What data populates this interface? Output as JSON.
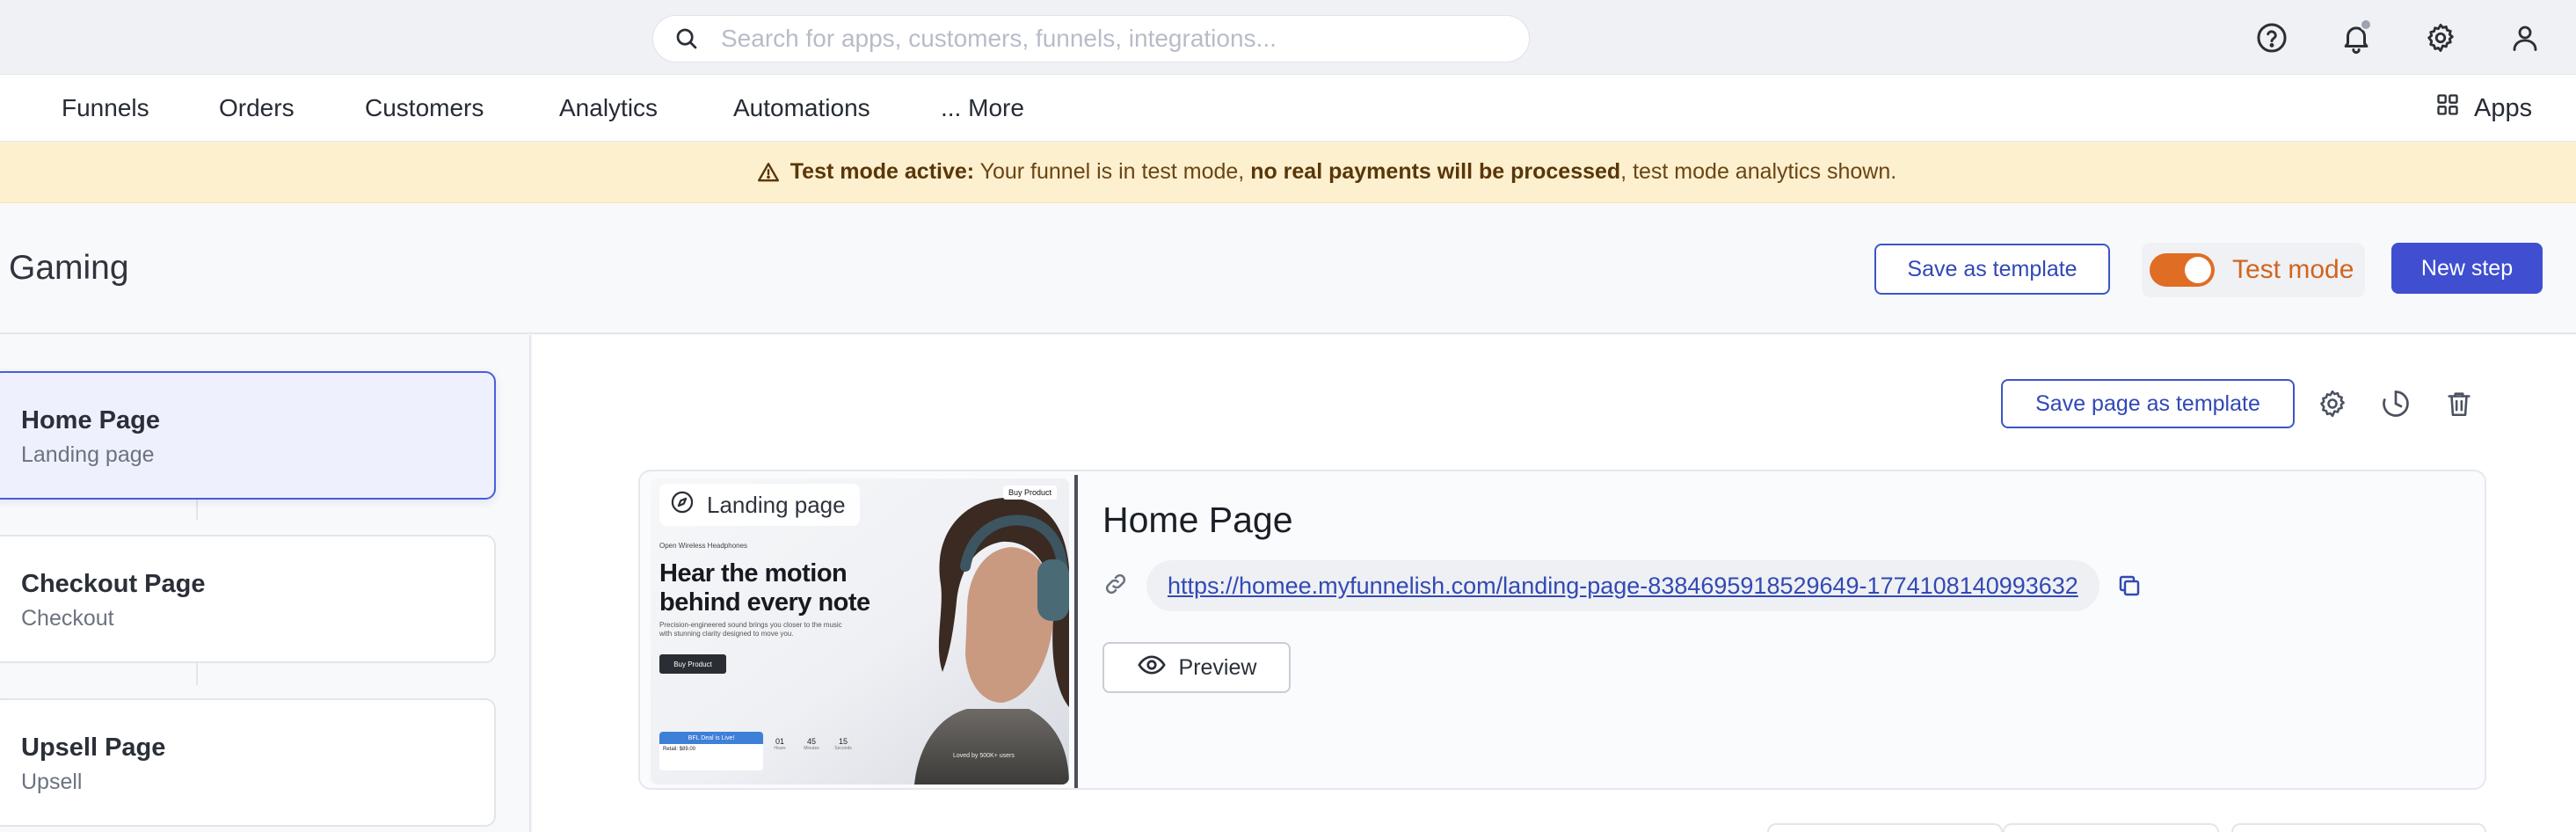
{
  "search": {
    "placeholder": "Search for apps, customers, funnels, integrations..."
  },
  "topbar": {
    "icons": [
      "help-icon",
      "bell-icon",
      "gear-icon",
      "user-icon"
    ]
  },
  "nav": {
    "items": [
      "Funnels",
      "Orders",
      "Customers",
      "Analytics",
      "Automations",
      "... More"
    ],
    "apps_label": "Apps"
  },
  "banner": {
    "bold_prefix": "Test mode active:",
    "text_1": " Your funnel is in test mode, ",
    "bold_middle": "no real payments will be processed",
    "text_2": ", test mode analytics shown.",
    "color": "#fcf0cf"
  },
  "header": {
    "title": "Gaming",
    "save_template_label": "Save as template",
    "test_mode_label": "Test mode",
    "test_mode_on": true,
    "new_step_label": "New step",
    "accent": "#3f4fd0",
    "toggle_color": "#e06d24"
  },
  "steps": [
    {
      "name": "Home Page",
      "type": "Landing page",
      "active": true
    },
    {
      "name": "Checkout Page",
      "type": "Checkout",
      "active": false
    },
    {
      "name": "Upsell Page",
      "type": "Upsell",
      "active": false
    }
  ],
  "main": {
    "save_page_template_label": "Save page as template",
    "card": {
      "tag_label": "Landing page",
      "title": "Home Page",
      "url": "https://homee.myfunnelish.com/landing-page-8384695918529649-1774108140993632",
      "preview_label": "Preview"
    },
    "thumbnail": {
      "buy_tag": "Buy Product",
      "brand_line": "Open Wireless Headphones",
      "headline": "Hear the motion behind every note",
      "subtext": "Precision-engineered sound brings you closer to the music with stunning clarity designed to move you.",
      "cta": "Buy Product",
      "offer_bar": "BFL Deal is Live!",
      "offer_body": "Retail: $89.00",
      "countdown": [
        {
          "value": "01",
          "unit": "Hours"
        },
        {
          "value": "45",
          "unit": "Minutes"
        },
        {
          "value": "15",
          "unit": "Seconds"
        }
      ],
      "social": "Loved by 500K+ users"
    }
  }
}
